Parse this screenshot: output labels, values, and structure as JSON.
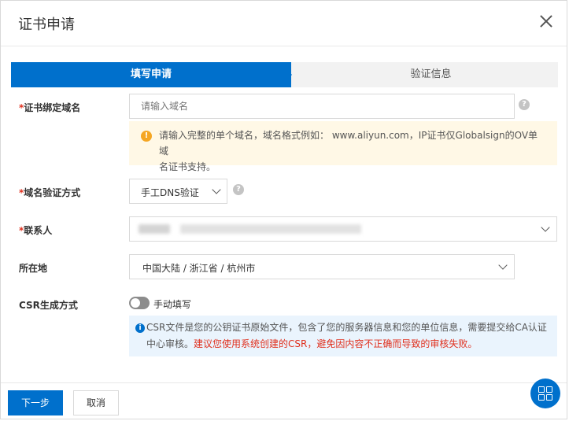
{
  "dialog": {
    "title": "证书申请"
  },
  "steps": {
    "step1": "填写申请",
    "step2": "验证信息"
  },
  "domain": {
    "label": "证书绑定域名",
    "placeholder": "请输入域名",
    "warning_line1": "请输入完整的单个域名，域名格式例如： www.aliyun.com，IP证书仅Globalsign的OV单域",
    "warning_line2": "名证书支持。"
  },
  "verify": {
    "label": "域名验证方式",
    "value": "手工DNS验证"
  },
  "contact": {
    "label": "联系人"
  },
  "location": {
    "label": "所在地",
    "value": "中国大陆 / 浙江省 / 杭州市"
  },
  "csr": {
    "label": "CSR生成方式",
    "toggle_label": "手动填写",
    "info_normal": "CSR文件是您的公钥证书原始文件，包含了您的服务器信息和您的单位信息，需要提交给CA认证中心审核。",
    "info_red": "建议您使用系统创建的CSR，避免因内容不正确而导致的审核失败。"
  },
  "footer": {
    "next": "下一步",
    "cancel": "取消"
  },
  "colors": {
    "primary": "#0070cc",
    "required": "#e0301e",
    "warning_bg": "#fff8e6",
    "info_bg": "#eaf4fd"
  },
  "icons": {
    "close": "close-icon",
    "help": "question-icon",
    "warning": "exclamation-icon",
    "info": "info-icon",
    "grid": "grid-icon"
  }
}
